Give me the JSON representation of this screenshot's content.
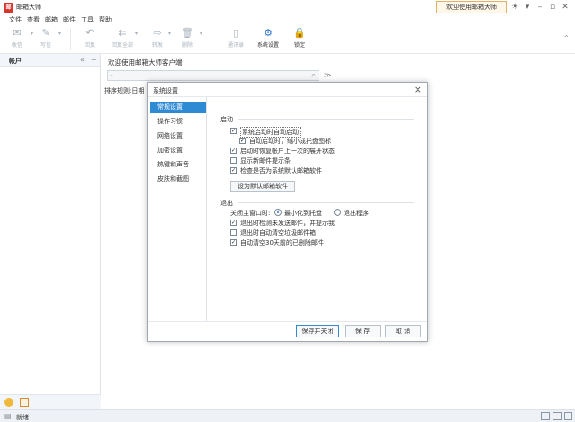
{
  "app": {
    "logo_text": "邮",
    "title": "邮箱大师",
    "welcome_banner": "欢迎使用邮箱大师"
  },
  "menu": [
    "文件",
    "查看",
    "邮箱",
    "邮件",
    "工具",
    "帮助"
  ],
  "toolbar": {
    "buttons": [
      {
        "label": "收信",
        "icon": "inbox-icon",
        "glyph": "✉"
      },
      {
        "label": "写信",
        "icon": "compose-icon",
        "glyph": "✎"
      },
      {
        "label": "回复",
        "icon": "reply-icon",
        "glyph": "↶"
      },
      {
        "label": "回复全部",
        "icon": "reply-all-icon",
        "glyph": "⇇"
      },
      {
        "label": "转发",
        "icon": "forward-icon",
        "glyph": "⇨"
      },
      {
        "label": "删除",
        "icon": "trash-icon",
        "glyph": "🗑"
      },
      {
        "label": "通讯录",
        "icon": "contacts-icon",
        "glyph": "▯"
      },
      {
        "label": "系统设置",
        "icon": "settings-icon",
        "glyph": "⚙"
      },
      {
        "label": "锁定",
        "icon": "lock-icon",
        "glyph": "🔒"
      }
    ]
  },
  "left_panel": {
    "header_label": "帐户",
    "collapse_glyph": "«",
    "add_glyph": "+"
  },
  "main": {
    "welcome": "欢迎使用邮箱大师客户端",
    "search_value": "-",
    "sort_label": "排序规则:日期 ("
  },
  "status": {
    "text": "就绪"
  },
  "dialog": {
    "title": "系统设置",
    "close_glyph": "×",
    "nav": [
      {
        "label": "常规设置",
        "active": true
      },
      {
        "label": "操作习惯",
        "active": false
      },
      {
        "label": "网络设置",
        "active": false
      },
      {
        "label": "加密设置",
        "active": false
      },
      {
        "label": "热键和声音",
        "active": false
      },
      {
        "label": "皮肤和截图",
        "active": false
      }
    ],
    "startup": {
      "label": "启动",
      "options": [
        {
          "label": "系统启动时自动启动",
          "checked": true
        },
        {
          "label": "自动启动时，缩小成托盘图标",
          "checked": true
        },
        {
          "label": "启动时恢复帐户上一次的展开状态",
          "checked": true
        },
        {
          "label": "显示新邮件提示条",
          "checked": false
        },
        {
          "label": "检查是否为系统默认邮箱软件",
          "checked": true
        }
      ],
      "set_default_button": "设为默认邮箱软件"
    },
    "exit": {
      "label": "退出",
      "close_main_label": "关闭主窗口时:",
      "radio_minimize": "最小化到托盘",
      "radio_exit": "退出程序",
      "options": [
        {
          "label": "退出时检测未发送邮件，并提示我",
          "checked": true
        },
        {
          "label": "退出时自动清空垃圾邮件箱",
          "checked": false
        },
        {
          "label": "自动清空30天前的已删除邮件",
          "checked": true
        }
      ]
    },
    "buttons": {
      "save_close": "保存并关闭",
      "save": "保 存",
      "cancel": "取 消"
    }
  }
}
